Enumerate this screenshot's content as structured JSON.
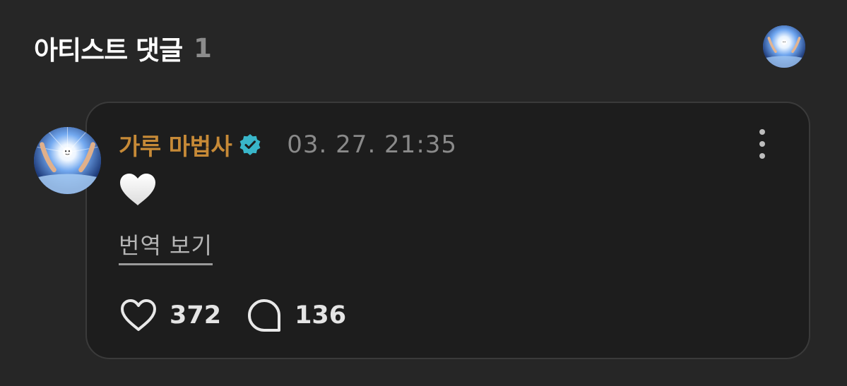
{
  "section": {
    "title": "아티스트 댓글",
    "count": "1"
  },
  "comment": {
    "author": "가루 마법사",
    "verified": true,
    "timestamp": "03. 27. 21:35",
    "body_emoji": "white-heart",
    "translate_label": "번역 보기",
    "like_count": "372",
    "reply_count": "136"
  },
  "colors": {
    "background": "#262626",
    "card": "#1d1d1d",
    "author": "#c78a37",
    "verified_badge": "#39b6c9",
    "muted_text": "#8a8a8a"
  },
  "icons": {
    "verified": "verified-badge-icon",
    "more": "more-vertical-icon",
    "like": "heart-outline-icon",
    "reply": "speech-bubble-icon"
  }
}
